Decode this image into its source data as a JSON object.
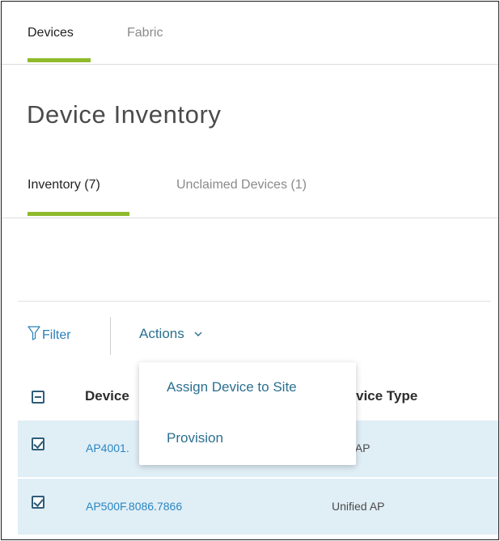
{
  "top_tabs": [
    {
      "label": "Devices",
      "active": true
    },
    {
      "label": "Fabric",
      "active": false
    }
  ],
  "page_title": "Device Inventory",
  "sub_tabs": [
    {
      "label": "Inventory (7)",
      "active": true
    },
    {
      "label": "Unclaimed Devices (1)",
      "active": false
    }
  ],
  "toolbar": {
    "filter_label": "Filter",
    "actions_label": "Actions"
  },
  "actions_menu": [
    "Assign Device to Site",
    "Provision"
  ],
  "table": {
    "columns": [
      "Device",
      "vice Type"
    ],
    "rows": [
      {
        "device": "AP4001.",
        "type": "ified AP",
        "checked": true
      },
      {
        "device": "AP500F.8086.7866",
        "type": "Unified AP",
        "checked": true
      }
    ]
  },
  "colors": {
    "accent_green": "#8fba2c",
    "link_blue": "#2a87c1",
    "row_selected": "#e0eef6"
  },
  "icons": [
    "filter-icon",
    "chevron-down-icon",
    "minus-checkbox-icon",
    "checkmark-icon"
  ]
}
